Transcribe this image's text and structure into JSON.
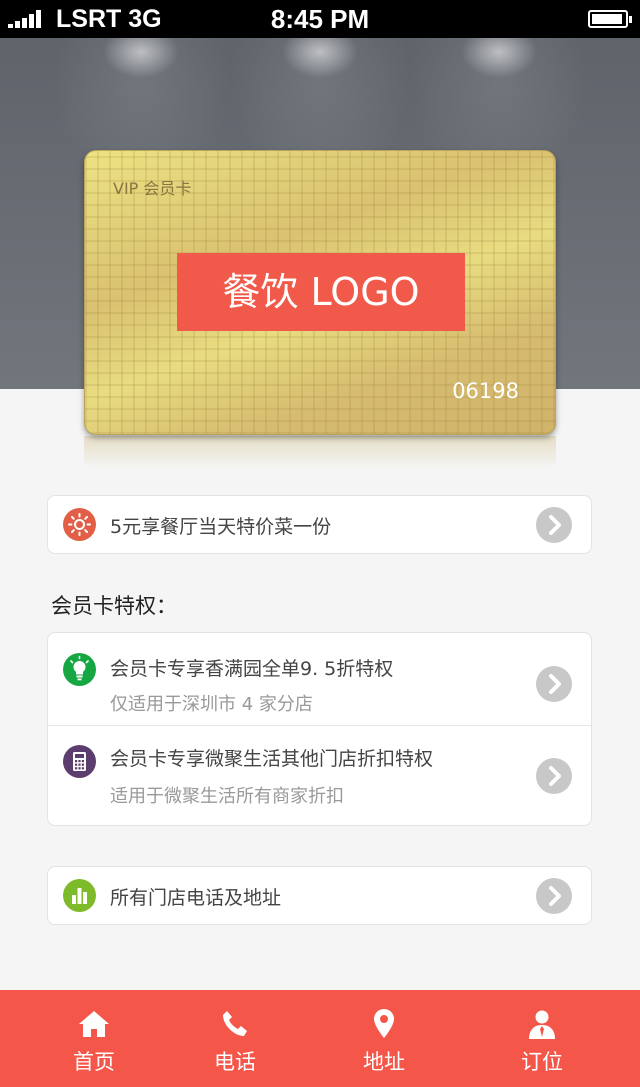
{
  "status_bar": {
    "carrier": "LSRT 3G",
    "time": "8:45 PM",
    "battery_level": 0.8
  },
  "card": {
    "title": "VIP 会员卡",
    "logo_text": "餐饮 LOGO",
    "number": "06198"
  },
  "promo": {
    "text": "5元享餐厅当天特价菜一份",
    "icon": "sun-icon",
    "icon_color": "#e25f47"
  },
  "privileges": {
    "title": "会员卡特权：",
    "items": [
      {
        "title": "会员卡专享香满园全单9. 5折特权",
        "subtitle": "仅适用于深圳市 4 家分店",
        "icon": "lightbulb-icon",
        "icon_color": "#16a743"
      },
      {
        "title": "会员卡专享微聚生活其他门店折扣特权",
        "subtitle": "适用于微聚生活所有商家折扣",
        "icon": "calculator-icon",
        "icon_color": "#5b3e6e"
      }
    ]
  },
  "stores": {
    "text": "所有门店电话及地址",
    "icon": "bar-chart-icon",
    "icon_color": "#7dbb2a"
  },
  "tab_bar": {
    "background": "#f5564a",
    "tabs": [
      {
        "label": "首页",
        "icon": "home-icon"
      },
      {
        "label": "电话",
        "icon": "phone-icon"
      },
      {
        "label": "地址",
        "icon": "location-pin-icon"
      },
      {
        "label": "订位",
        "icon": "person-icon"
      }
    ]
  }
}
